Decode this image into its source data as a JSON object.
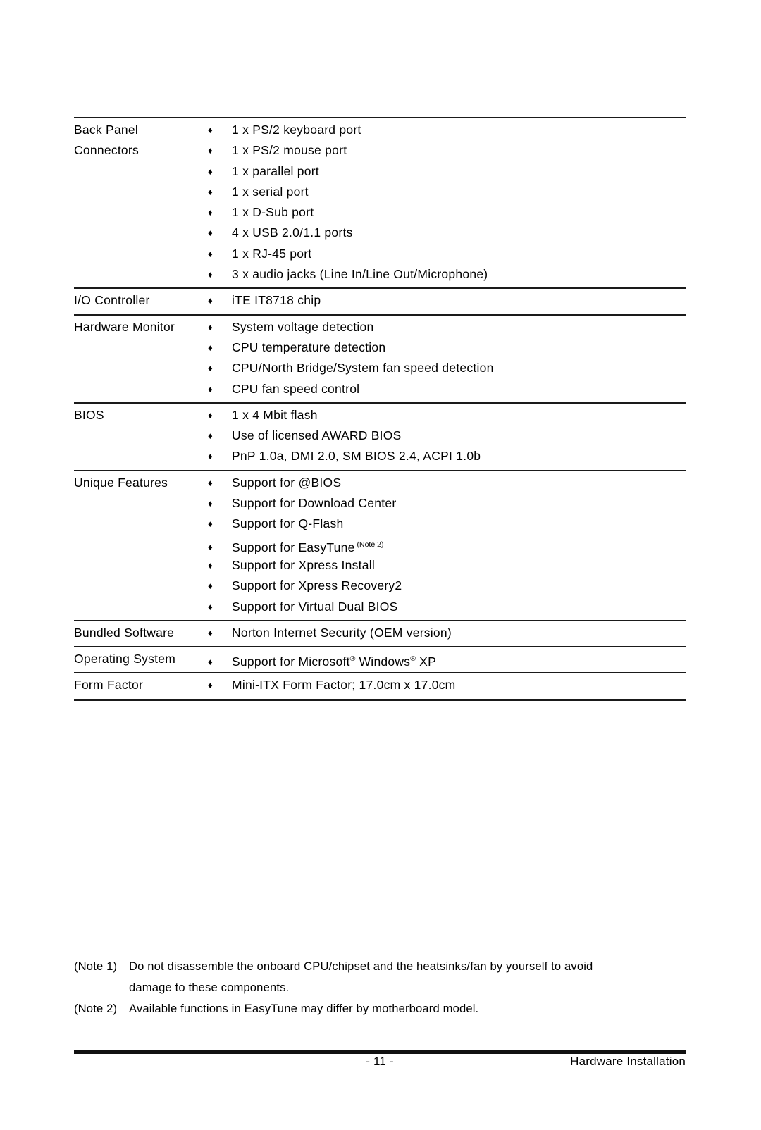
{
  "document": {
    "page_number": "- 11 -",
    "section_title": "Hardware Installation",
    "bullet_glyph": "♦"
  },
  "spec_table": {
    "rows": [
      {
        "category": "Back Panel\nConnectors",
        "items": [
          "1 x PS/2 keyboard port",
          "1 x PS/2 mouse port",
          "1 x parallel port",
          "1 x serial port",
          "1 x D-Sub port",
          "4 x USB 2.0/1.1 ports",
          "1 x RJ-45 port",
          "3 x audio jacks (Line In/Line Out/Microphone)"
        ]
      },
      {
        "category": "I/O Controller",
        "items": [
          "iTE IT8718 chip"
        ]
      },
      {
        "category": "Hardware Monitor",
        "items": [
          "System voltage detection",
          "CPU temperature detection",
          "CPU/North Bridge/System fan speed detection",
          "CPU fan speed control"
        ]
      },
      {
        "category": "BIOS",
        "items": [
          "1 x 4 Mbit flash",
          "Use of licensed AWARD BIOS",
          "PnP 1.0a, DMI 2.0, SM BIOS 2.4, ACPI 1.0b"
        ]
      },
      {
        "category": "Unique Features",
        "items": [
          "Support for @BIOS",
          "Support for Download Center",
          "Support for Q-Flash",
          "Support for EasyTune",
          "Support for Xpress Install",
          "Support for Xpress Recovery2",
          "Support for Virtual Dual BIOS"
        ],
        "item_superscripts": {
          "3": "(Note 2)"
        }
      },
      {
        "category": "Bundled Software",
        "items": [
          "Norton Internet Security (OEM version)"
        ]
      },
      {
        "category": "Operating System",
        "items": [
          "Support for Microsoft® Windows® XP"
        ],
        "item_html": {
          "0": "Support for Microsoft<span class=\"reg\">®</span> Windows<span class=\"reg\">®</span> XP"
        }
      },
      {
        "category": "Form Factor",
        "items": [
          "Mini-ITX Form Factor; 17.0cm x 17.0cm"
        ]
      }
    ]
  },
  "notes": [
    {
      "label": "(Note 1)",
      "line1": "Do not disassemble the onboard CPU/chipset and the heatsinks/fan by yourself to avoid",
      "line2": "damage to these components."
    },
    {
      "label": "(Note 2)",
      "line1": "Available functions in EasyTune may differ by motherboard model.",
      "line2": ""
    }
  ]
}
